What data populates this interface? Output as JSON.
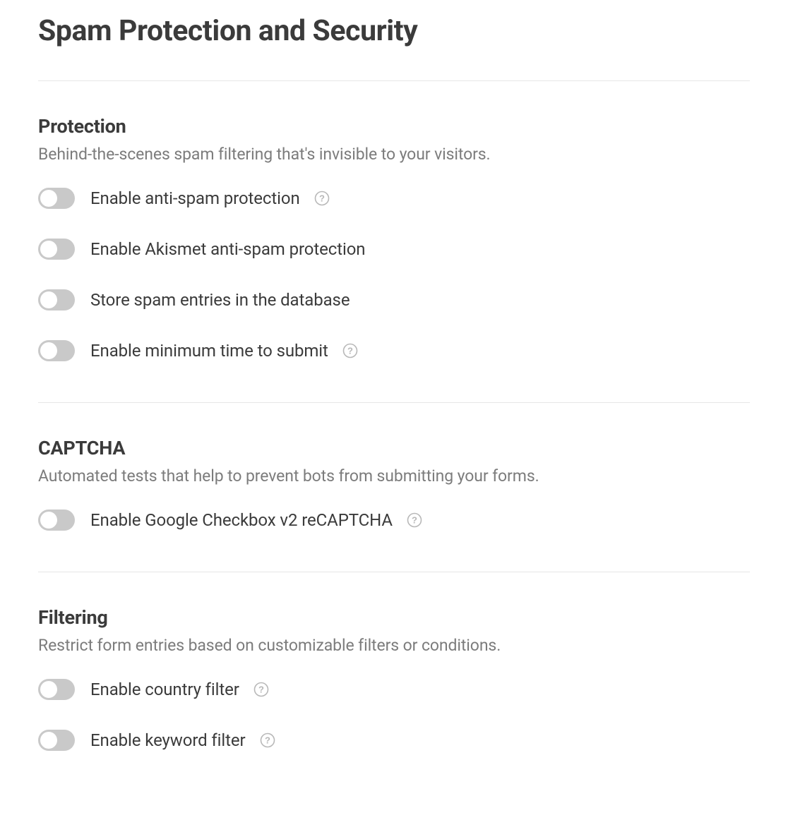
{
  "title": "Spam Protection and Security",
  "sections": {
    "protection": {
      "heading": "Protection",
      "desc": "Behind-the-scenes spam filtering that's invisible to your visitors.",
      "items": [
        {
          "label": "Enable anti-spam protection",
          "help": true
        },
        {
          "label": "Enable Akismet anti-spam protection",
          "help": false
        },
        {
          "label": "Store spam entries in the database",
          "help": false
        },
        {
          "label": "Enable minimum time to submit",
          "help": true
        }
      ]
    },
    "captcha": {
      "heading": "CAPTCHA",
      "desc": "Automated tests that help to prevent bots from submitting your forms.",
      "items": [
        {
          "label": "Enable Google Checkbox v2 reCAPTCHA",
          "help": true
        }
      ]
    },
    "filtering": {
      "heading": "Filtering",
      "desc": "Restrict form entries based on customizable filters or conditions.",
      "items": [
        {
          "label": "Enable country filter",
          "help": true
        },
        {
          "label": "Enable keyword filter",
          "help": true
        }
      ]
    }
  }
}
